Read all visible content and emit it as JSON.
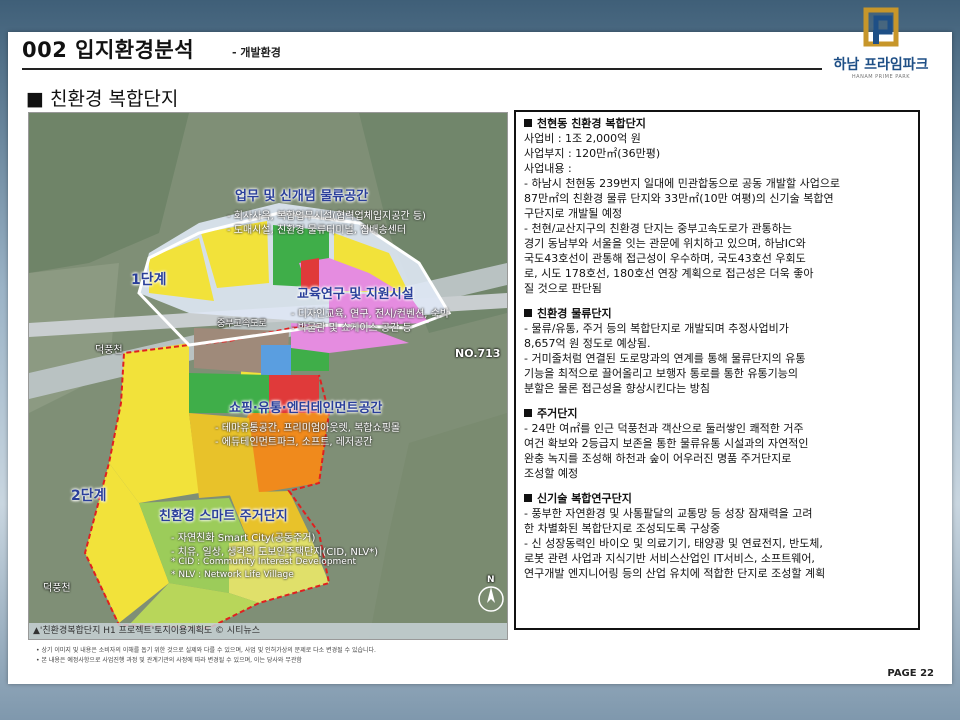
{
  "header": {
    "title": "002 입지환경분석",
    "subtitle": "- 개발환경",
    "logo_name": "하남 프라임파크",
    "logo_sub": "HANAM PRIME PARK"
  },
  "section_heading": "■ 친환경 복합단지",
  "map": {
    "labels": {
      "zone_logistics": "업무 및 신개념 물류공간",
      "zone_logistics_b1": "- 회사사옥, 복합업무시설(협력업체입지공간 등)",
      "zone_logistics_b2": "- 도매시설, 친환경 물류터미널, 집배송센터",
      "phase1": "1단계",
      "zone_edu": "교육연구 및 지원시설",
      "zone_edu_b1": "- 디자인교육, 연구, 전시/컨벤션, 숙박",
      "zone_edu_b2": "- 박물관 및 쇼케이스 공간 등",
      "highway": "중부고속도로",
      "deokpung": "덕풍천",
      "road": "NO.713",
      "zone_shopping": "쇼핑·유통·엔터테인먼트공간",
      "zone_shopping_b1": "- 테마유통공간, 프리미엄아웃렛, 복합쇼핑몰",
      "zone_shopping_b2": "- 에듀테인먼트파크, 소프트, 레저공간",
      "phase2": "2단계",
      "zone_housing": "친환경 스마트 주거단지",
      "zone_housing_b1": "- 자연친화 Smart City(공동주거)",
      "zone_housing_b2": "- 치유, 일상, 생각의 도보인주택단지(CID, NLV*)",
      "zone_housing_b3": "* CID : Community Interest Development",
      "zone_housing_b4": "* NLV : Network Life Village",
      "deokpung2": "덕풍천",
      "north": "N"
    },
    "caption": "▲'친환경복합단지 H1 프로젝트'토지이용계획도    © 시티뉴스"
  },
  "info": {
    "s1_head": "천현동 친환경 복합단지",
    "s1_l1": "사업비 : 1조 2,000억 원",
    "s1_l2": "사업부지 : 120만㎡(36만평)",
    "s1_l3": "사업내용 :",
    "s1_l4": "-  하남시 천현동 239번지 일대에 민관합동으로 공동 개발할 사업으로",
    "s1_l5": "    87만㎡의 친환경 물류 단지와 33만㎡(10만 여평)의 신기술 복합연",
    "s1_l6": "    구단지로 개발될 예정",
    "s1_l7": "  - 천현/교산지구의 친환경 단지는 중부고속도로가 관통하는",
    "s1_l8": "      경기 동남부와 서울을 잇는 관문에 위치하고 있으며, 하남IC와",
    "s1_l9": "      국도43호선이 관통해 접근성이 우수하며, 국도43호선 우회도",
    "s1_l10": "      로, 시도 178호선, 180호선 연장 계획으로 접근성은 더욱 좋아",
    "s1_l11": "      질 것으로 판단됨",
    "s2_head": "친환경 물류단지",
    "s2_l1": "  - 물류/유통, 주거 등의 복합단지로 개발되며 추정사업비가",
    "s2_l2": "      8,657억 원 정도로 예상됨.",
    "s2_l3": "  - 거미줄처럼 연결된 도로망과의 연계를 통해 물류단지의 유통",
    "s2_l4": "      기능을 최적으로 끌어올리고 보행자 통로를 통한 유통기능의",
    "s2_l5": "      분할은 물론 접근성을 향상시킨다는 방침",
    "s3_head": "주거단지",
    "s3_l1": "  - 24만 여㎡를 인근 덕풍천과 객산으로 둘러쌓인 쾌적한 거주",
    "s3_l2": "      여건 확보와 2등급지 보존을 통한 물류유통 시설과의 자연적인",
    "s3_l3": "      완충 녹지를 조성해 하천과 숲이 어우러진  명품 주거단지로",
    "s3_l4": "      조성할 예정",
    "s4_head": "신기술 복합연구단지",
    "s4_l1": "  - 풍부한 자연환경 및 사통팔달의 교통망 등 성장 잠재력을 고려",
    "s4_l2": "      한 차별화된 복합단지로 조성되도록 구상중",
    "s4_l3": "  - 신 성장동력인 바이오 및 의료기기, 태양광 및 연료전지, 반도체,",
    "s4_l4": "      로봇 관련 사업과 지식기반 서비스산업인 IT서비스, 소프트웨어,",
    "s4_l5": "      연구개발 엔지니어링 등의 산업 유치에 적합한 단지로 조성할 계획"
  },
  "footnotes": {
    "n1": "•    상기 이미지 및 내용은 소비자의 이해를 돕기 위한 것으로 실제와 다를 수 있으며, 사업 및 인허가상의 문제로 다소 변경될 수 있습니다.",
    "n2": "•    본 내용은 예정사항으로 사업진행 과정 및 관계기관의 사정에 따라 변경될 수 있으며, 이는 당사와 무관함"
  },
  "page_number": "PAGE 22",
  "colors": {
    "brand_blue": "#1e4f86",
    "logo_gold": "#c7962a",
    "zone_yellow": "#f2e23a",
    "zone_orange": "#f08a1c",
    "zone_magenta": "#e58ce0",
    "zone_green": "#3fae49",
    "zone_blue": "#5a9ee0",
    "zone_red": "#e03a3a",
    "boundary_red": "#e02020"
  }
}
